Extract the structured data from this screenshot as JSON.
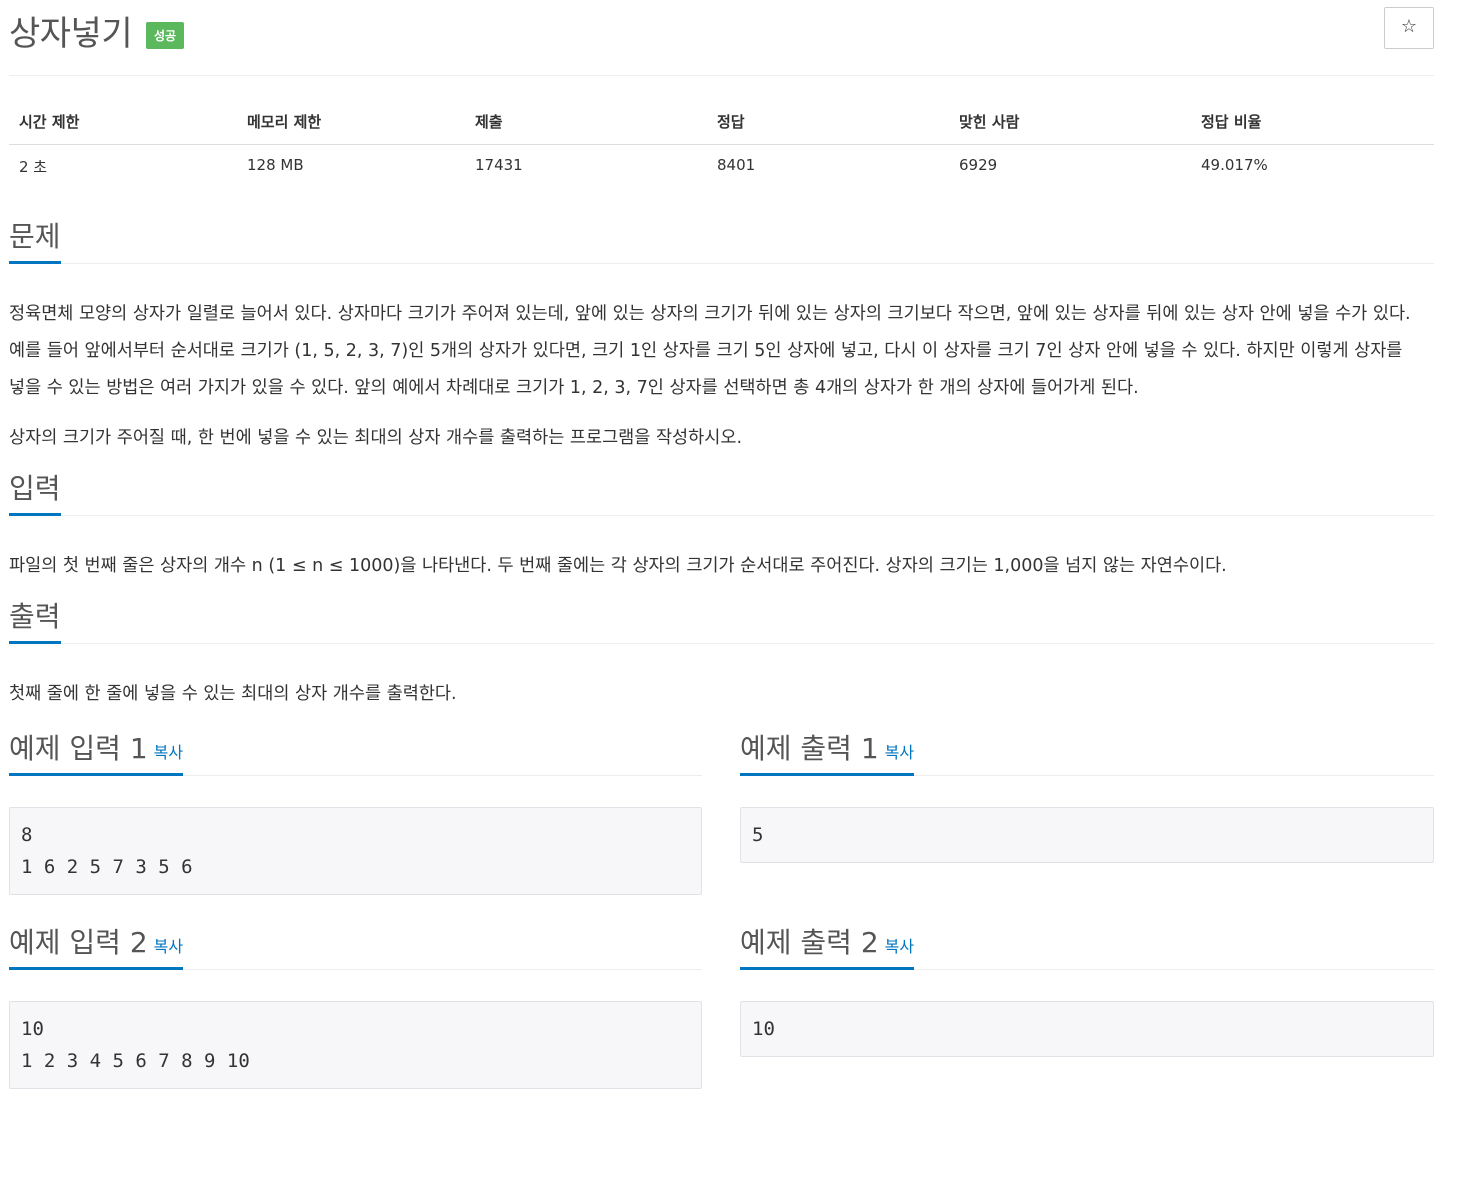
{
  "problem": {
    "title": "상자넣기",
    "status_badge": "성공",
    "star_icon": "☆"
  },
  "stats": {
    "headers": [
      "시간 제한",
      "메모리 제한",
      "제출",
      "정답",
      "맞힌 사람",
      "정답 비율"
    ],
    "values": [
      "2 초",
      "128 MB",
      "17431",
      "8401",
      "6929",
      "49.017%"
    ]
  },
  "sections": {
    "description_title": "문제",
    "description_p1": "정육면체 모양의 상자가 일렬로 늘어서 있다. 상자마다 크기가 주어져 있는데, 앞에 있는 상자의 크기가 뒤에 있는 상자의 크기보다 작으면, 앞에 있는 상자를 뒤에 있는 상자 안에 넣을 수가 있다. 예를 들어 앞에서부터 순서대로 크기가 (1, 5, 2, 3, 7)인 5개의 상자가 있다면, 크기 1인 상자를 크기 5인 상자에 넣고, 다시 이 상자를 크기 7인 상자 안에 넣을 수 있다. 하지만 이렇게 상자를 넣을 수 있는 방법은 여러 가지가 있을 수 있다. 앞의 예에서 차례대로 크기가 1, 2, 3, 7인 상자를 선택하면 총 4개의 상자가 한 개의 상자에 들어가게 된다.",
    "description_p2": "상자의 크기가 주어질 때, 한 번에 넣을 수 있는 최대의 상자 개수를 출력하는 프로그램을 작성하시오.",
    "input_title": "입력",
    "input_text": "파일의 첫 번째 줄은 상자의 개수 n (1 ≤ n ≤ 1000)을 나타낸다. 두 번째 줄에는 각 상자의 크기가 순서대로 주어진다. 상자의 크기는 1,000을 넘지 않는 자연수이다.",
    "output_title": "출력",
    "output_text": "첫째 줄에 한 줄에 넣을 수 있는 최대의 상자 개수를 출력한다."
  },
  "samples": {
    "copy_label": "복사",
    "input1_title": "예제 입력 1",
    "output1_title": "예제 출력 1",
    "input1": "8\n1 6 2 5 7 3 5 6",
    "output1": "5",
    "input2_title": "예제 입력 2",
    "output2_title": "예제 출력 2",
    "input2": "10\n1 2 3 4 5 6 7 8 9 10",
    "output2": "10"
  },
  "colors": {
    "accent": "#0076c0",
    "success": "#5cb85c"
  }
}
